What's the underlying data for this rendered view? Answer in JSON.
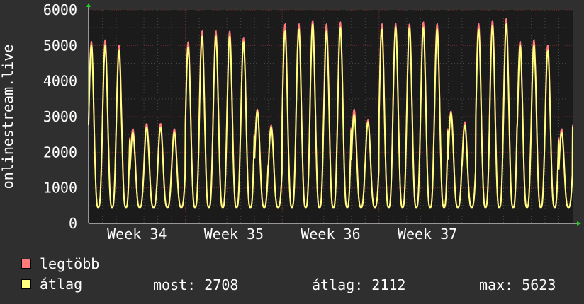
{
  "colors": {
    "background": "#2f2f2f",
    "plot_background": "#1b1b1b",
    "grid_major": "#6b2a2a",
    "grid_minor": "#474747",
    "axis": "#ffffff",
    "arrow": "#22cc22",
    "series_max": "#ff7b7b",
    "series_avg": "#ffff80"
  },
  "legend": {
    "items": [
      {
        "label": "legtöbb",
        "color": "#ff7b7b"
      },
      {
        "label": "átlag",
        "color": "#ffff80"
      }
    ],
    "stats": {
      "now": "most: 2708",
      "avg": "átlag: 2112",
      "max": "max: 5623"
    }
  },
  "chart_data": {
    "type": "line",
    "ylabel": "onlinestream.live",
    "ylim": [
      0,
      6000
    ],
    "y_ticks": [
      0,
      1000,
      2000,
      3000,
      4000,
      5000,
      6000
    ],
    "x_ticks": [
      "Week 34",
      "Week 35",
      "Week 36",
      "Week 37"
    ],
    "x_range_days": [
      0,
      35
    ],
    "grid": true,
    "legend_position": "bottom-left",
    "series": [
      {
        "name": "legtöbb",
        "color": "#ff7b7b",
        "daily_peaks": [
          5100,
          5150,
          5000,
          2650,
          2800,
          2800,
          2650,
          5100,
          5400,
          5400,
          5400,
          5200,
          3200,
          2750,
          5600,
          5600,
          5700,
          5600,
          5650,
          3200,
          2900,
          5600,
          5600,
          5600,
          5650,
          5600,
          3150,
          2850,
          5600,
          5700,
          5750
        ]
      },
      {
        "name": "átlag",
        "color": "#ffff80",
        "daily_peaks": [
          5000,
          5000,
          4850,
          2550,
          2700,
          2700,
          2550,
          4950,
          5250,
          5250,
          5250,
          5100,
          3150,
          2700,
          5400,
          5450,
          5600,
          5400,
          5500,
          3050,
          2850,
          5450,
          5500,
          5500,
          5500,
          5450,
          3100,
          2750,
          5450,
          5550,
          5600
        ]
      }
    ],
    "daily_trough": 450,
    "last_value": 2708
  }
}
